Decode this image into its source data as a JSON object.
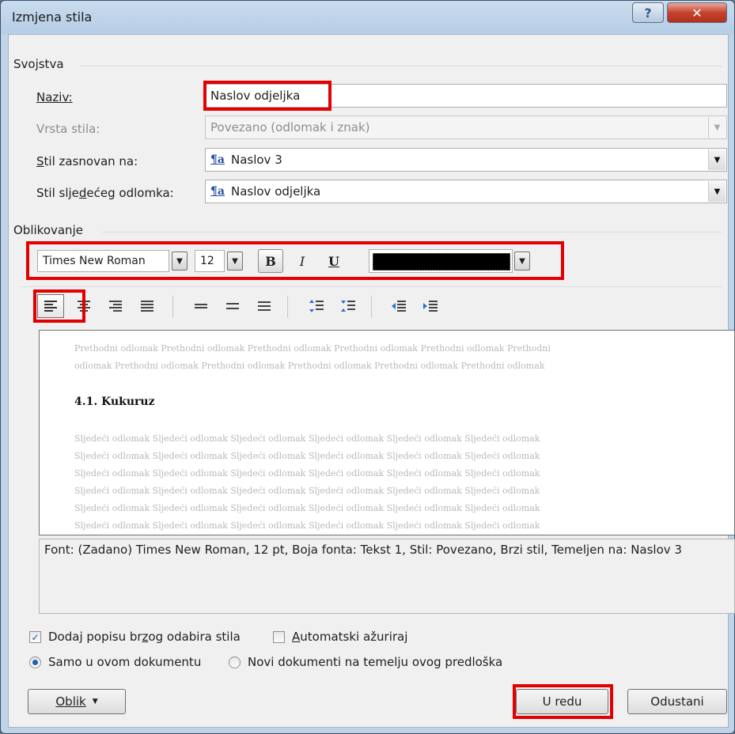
{
  "window": {
    "title": "Izmjena stila",
    "help_glyph": "?",
    "close_glyph": "✕"
  },
  "properties": {
    "group_label": "Svojstva",
    "name_label": "Naziv:",
    "name_value": "Naslov odjeljka",
    "type_label": "Vrsta stila:",
    "type_value": "Povezano (odlomak i znak)",
    "based_label": "Stil zasnovan na:",
    "based_value": "Naslov 3",
    "next_label": "Stil sljedećeg odlomka:",
    "next_value": "Naslov odjeljka",
    "style_icon": "¶a"
  },
  "formatting": {
    "group_label": "Oblikovanje",
    "font_name": "Times New Roman",
    "font_size": "12",
    "bold": "B",
    "italic": "I",
    "underline": "U",
    "font_color": "#000000"
  },
  "preview": {
    "previous_lines": [
      "Prethodni odlomak Prethodni odlomak Prethodni odlomak Prethodni odlomak Prethodni odlomak Prethodni",
      "odlomak Prethodni odlomak Prethodni odlomak Prethodni odlomak Prethodni odlomak Prethodni odlomak"
    ],
    "heading": "4.1. Kukuruz",
    "next_lines": [
      "Sljedeći odlomak Sljedeći odlomak Sljedeći odlomak Sljedeći odlomak Sljedeći odlomak Sljedeći odlomak",
      "Sljedeći odlomak Sljedeći odlomak Sljedeći odlomak Sljedeći odlomak Sljedeći odlomak Sljedeći odlomak",
      "Sljedeći odlomak Sljedeći odlomak Sljedeći odlomak Sljedeći odlomak Sljedeći odlomak Sljedeći odlomak",
      "Sljedeći odlomak Sljedeći odlomak Sljedeći odlomak Sljedeći odlomak Sljedeći odlomak Sljedeći odlomak",
      "Sljedeći odlomak Sljedeći odlomak Sljedeći odlomak Sljedeći odlomak Sljedeći odlomak Sljedeći odlomak",
      "Sljedeći odlomak Sljedeći odlomak Sljedeći odlomak Sljedeći odlomak Sljedeći odlomak Sljedeći odlomak"
    ]
  },
  "description": "Font: (Zadano) Times New Roman, 12 pt, Boja fonta: Tekst 1, Stil: Povezano, Brzi stil, Temeljen na: Naslov 3",
  "options": {
    "add_quick_style": "Dodaj popisu brzog odabira stila",
    "add_quick_style_checked": true,
    "auto_update": "Automatski ažuriraj",
    "auto_update_checked": false,
    "only_this_doc": "Samo u ovom dokumentu",
    "new_docs": "Novi dokumenti na temelju ovog predloška",
    "selected_scope": "only_this_doc"
  },
  "buttons": {
    "format": "Oblik",
    "ok": "U redu",
    "cancel": "Odustani"
  },
  "colors": {
    "highlight": "#e30000",
    "title_bar": "#bfd3e9",
    "dialog_bg": "#f0f0f0"
  }
}
